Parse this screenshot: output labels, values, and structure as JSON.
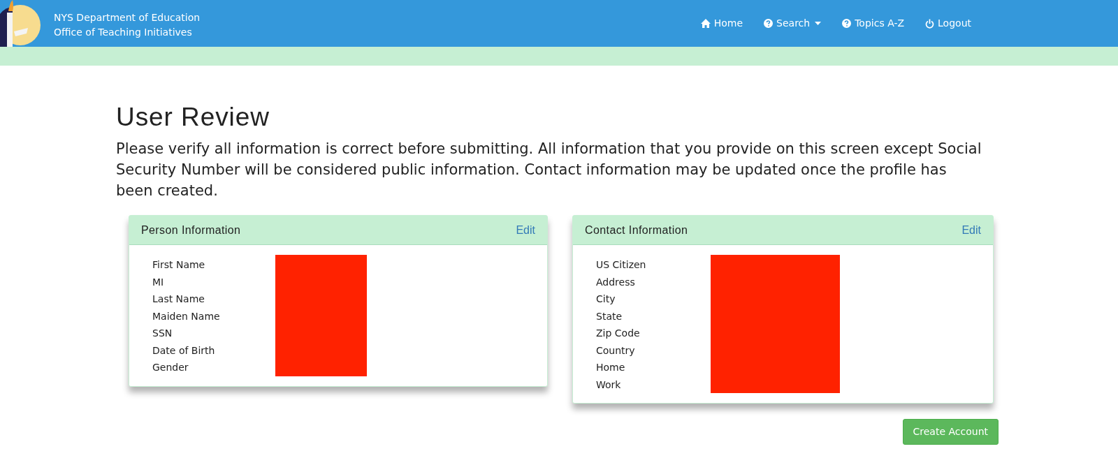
{
  "header": {
    "title_lines": [
      "NYS Department of Education",
      "Office of Teaching Initiatives"
    ],
    "nav": [
      {
        "kind": "home",
        "label": "Home",
        "dropdown": false
      },
      {
        "kind": "help",
        "label": "Search",
        "dropdown": true
      },
      {
        "kind": "help",
        "label": "Topics A-Z",
        "dropdown": false
      },
      {
        "kind": "power",
        "label": "Logout",
        "dropdown": false
      }
    ]
  },
  "page": {
    "title": "User Review",
    "intro": "Please verify all information is correct before submitting. All information that you provide on this screen except Social Security Number will be considered public information. Contact information may be updated once the profile has been created."
  },
  "cards": [
    {
      "title": "Person Information",
      "action": "Edit",
      "fields": [
        "First Name",
        "MI",
        "Last Name",
        "Maiden Name",
        "SSN",
        "Date of Birth",
        "Gender"
      ]
    },
    {
      "title": "Contact Information",
      "action": "Edit",
      "fields": [
        "US Citizen",
        "Address",
        "City",
        "State",
        "Zip Code",
        "Country",
        "Home",
        "Work"
      ]
    }
  ],
  "submit_button": "Create Account"
}
